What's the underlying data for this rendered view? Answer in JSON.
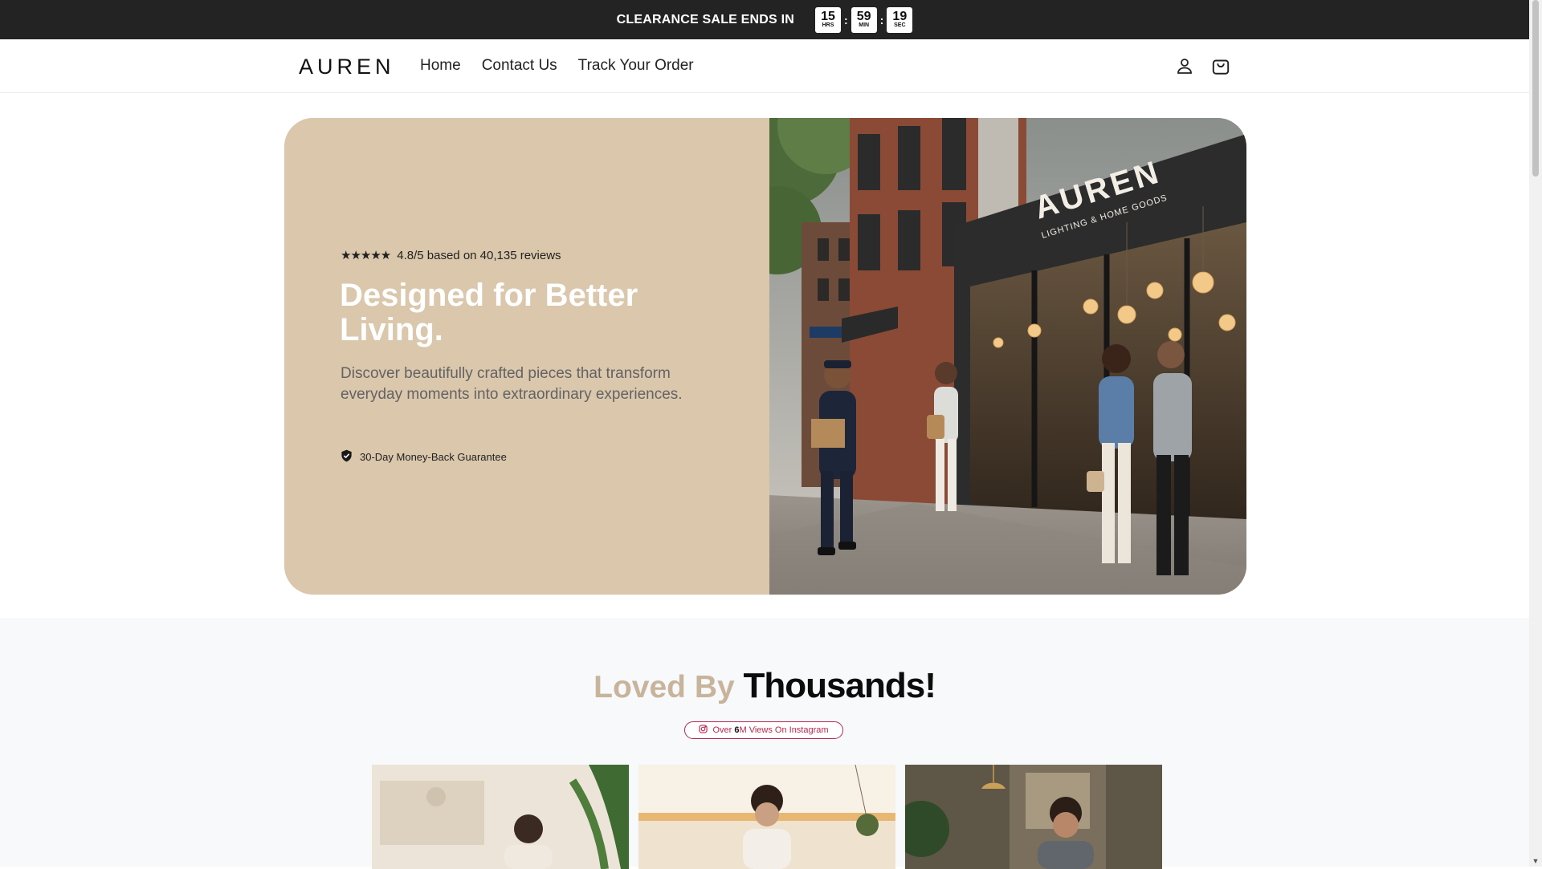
{
  "announcement": {
    "text": "CLEARANCE SALE ENDS IN",
    "timer": [
      {
        "value": "15",
        "label": "HRS"
      },
      {
        "value": "59",
        "label": "MIN"
      },
      {
        "value": "19",
        "label": "SEC"
      }
    ],
    "separator": ":"
  },
  "header": {
    "logo": "AUREN",
    "nav": [
      "Home",
      "Contact Us",
      "Track Your Order"
    ],
    "icons": [
      "account-icon",
      "cart-icon"
    ]
  },
  "hero": {
    "stars": "★★★★★",
    "rating_text": "4.8/5 based on 40,135 reviews",
    "title": "Designed for Better Living.",
    "description": "Discover beautifully crafted pieces that transform everyday moments into extraordinary experiences.",
    "guarantee": "30-Day Money-Back Guarantee",
    "store_sign": "AUREN",
    "store_sub": "LIGHTING & HOME GOODS",
    "bg_color": "#dac7ac"
  },
  "loved": {
    "title_part1": "Loved By ",
    "title_part2": "Thousands!",
    "pill_prefix": "Over ",
    "pill_bold": "6",
    "pill_suffix": "M Views On Instagram"
  },
  "colors": {
    "announcement_bg": "#232323",
    "accent_beige": "#c8b49b",
    "instagram": "#b3284f"
  }
}
